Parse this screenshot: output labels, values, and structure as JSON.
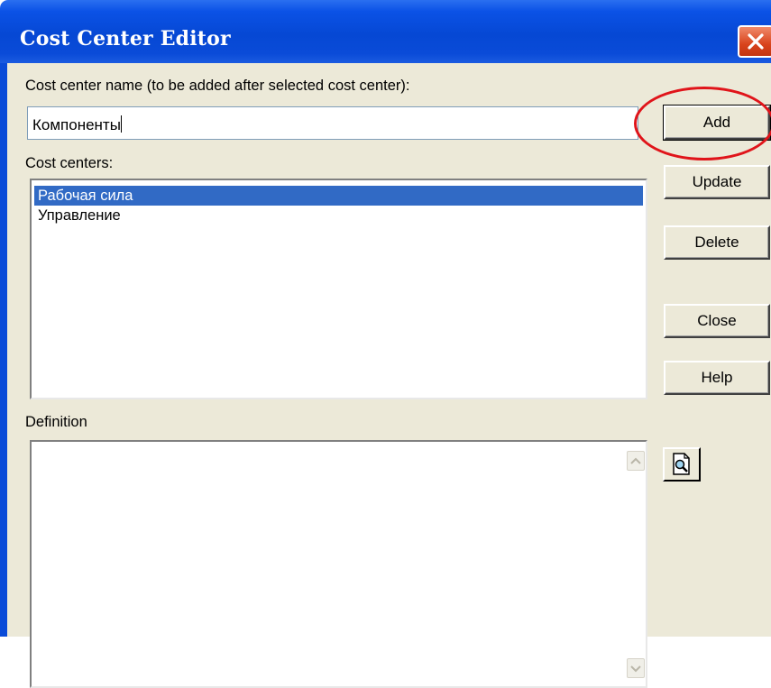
{
  "window": {
    "title": "Cost Center Editor",
    "close_icon": "close-icon"
  },
  "form": {
    "name_label": "Cost center name (to be added after selected cost center):",
    "name_value": "Компоненты",
    "centers_label": "Cost centers:",
    "centers": [
      {
        "label": "Рабочая сила",
        "selected": true
      },
      {
        "label": "Управление",
        "selected": false
      }
    ],
    "definition_label": "Definition",
    "definition_value": ""
  },
  "buttons": {
    "add": "Add",
    "update": "Update",
    "delete": "Delete",
    "close": "Close",
    "help": "Help",
    "preview_icon": "document-magnifier-icon"
  },
  "colors": {
    "titlebar": "#0a4bd8",
    "dialog_bg": "#ece9d8",
    "selection": "#316ac5",
    "annotation": "#e0141a"
  }
}
